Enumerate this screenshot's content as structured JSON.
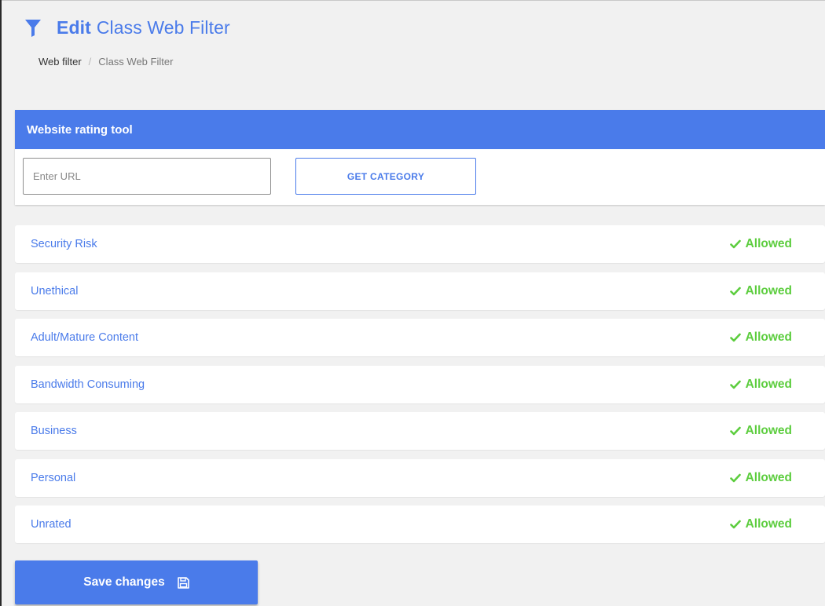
{
  "header": {
    "icon": "filter-icon",
    "title_strong": "Edit",
    "title_rest": "Class Web Filter",
    "accent_color": "#4a7bea"
  },
  "breadcrumb": {
    "items": [
      "Web filter",
      "Class Web Filter"
    ],
    "separator": "/"
  },
  "rating_tool": {
    "title": "Website rating tool",
    "url_input": {
      "value": "",
      "placeholder": "Enter URL"
    },
    "get_button_label": "GET CATEGORY"
  },
  "categories": [
    {
      "name": "Security Risk",
      "status": "Allowed",
      "status_icon": "check-icon"
    },
    {
      "name": "Unethical",
      "status": "Allowed",
      "status_icon": "check-icon"
    },
    {
      "name": "Adult/Mature Content",
      "status": "Allowed",
      "status_icon": "check-icon"
    },
    {
      "name": "Bandwidth Consuming",
      "status": "Allowed",
      "status_icon": "check-icon"
    },
    {
      "name": "Business",
      "status": "Allowed",
      "status_icon": "check-icon"
    },
    {
      "name": "Personal",
      "status": "Allowed",
      "status_icon": "check-icon"
    },
    {
      "name": "Unrated",
      "status": "Allowed",
      "status_icon": "check-icon"
    }
  ],
  "status_color": "#5ccd3e",
  "save_button": {
    "label": "Save changes",
    "icon": "floppy-disk-icon"
  }
}
